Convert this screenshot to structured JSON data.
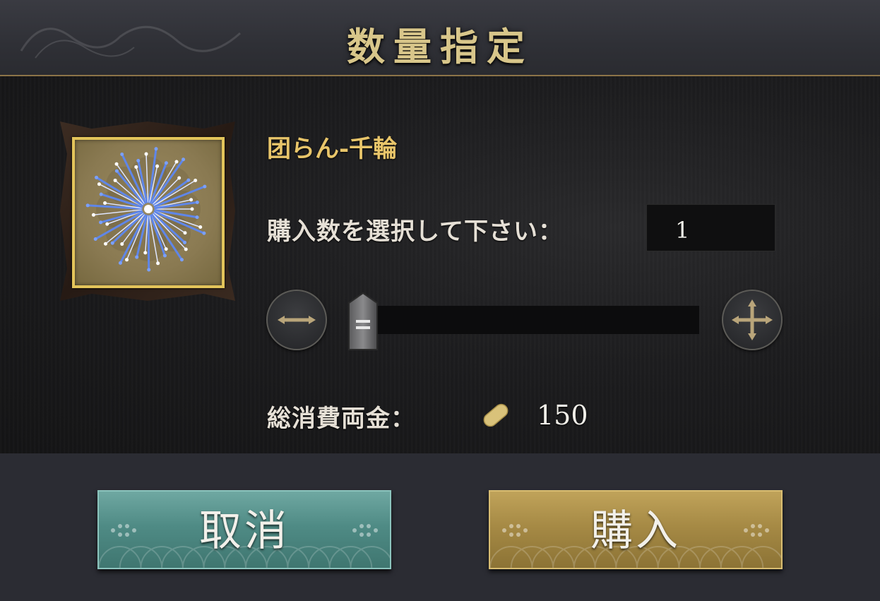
{
  "dialog": {
    "title": "数量指定"
  },
  "item": {
    "name": "团らん-千輪",
    "image_icon": "firework-icon"
  },
  "quantity": {
    "prompt": "購入数を選択して下さい：",
    "value": "1",
    "slider_level": 0
  },
  "controls": {
    "minus_icon": "minus-arrow-icon",
    "plus_icon": "plus-arrow-icon"
  },
  "cost": {
    "label": "総消費両金：",
    "currency_icon": "gold-coin-icon",
    "value": "150"
  },
  "buttons": {
    "cancel": "取消",
    "buy": "購入"
  },
  "colors": {
    "title_gold": "#d8c68a",
    "item_name_gold": "#e8c56a",
    "cancel_teal": "#4f8b85",
    "buy_gold": "#a68a45",
    "frame_border": "#e3c45a"
  }
}
